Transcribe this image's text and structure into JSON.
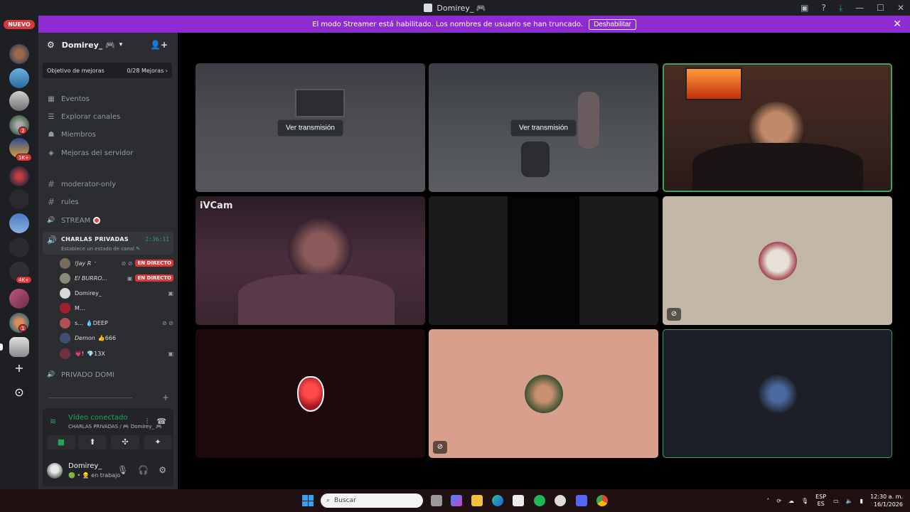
{
  "window": {
    "title": "Domirey_ 🎮"
  },
  "streamer_bar": {
    "message": "El modo Streamer está habilitado. Los nombres de usuario se han truncado.",
    "disable_label": "Deshabilitar",
    "close": "✕"
  },
  "guilds": {
    "nuevo": "NUEVO",
    "badges": [
      "2",
      "1K+",
      "4K+",
      "1"
    ]
  },
  "server": {
    "name": "Domirey_ 🎮",
    "goal_label": "Objetivo de mejoras",
    "goal_value": "0/28 Mejoras ›"
  },
  "menu": [
    {
      "label": "Eventos",
      "icon": "▦"
    },
    {
      "label": "Explorar canales",
      "icon": "☰"
    },
    {
      "label": "Miembros",
      "icon": "☗"
    },
    {
      "label": "Mejoras del servidor",
      "icon": "◈"
    }
  ],
  "channels": [
    {
      "label": "moderator-only",
      "icon": "#"
    },
    {
      "label": "rules",
      "icon": "#"
    },
    {
      "label": "STREAM",
      "icon": "🔊"
    }
  ],
  "active_voice": {
    "name": "CHARLAS PRIVADAS",
    "timer": "2:36:11",
    "status": "Establece un estado de canal ✎"
  },
  "members": [
    {
      "name": "!Jay R",
      "suffix": "ᐩ",
      "live": "EN DIRECTO",
      "color": "#7a6a5a",
      "icons": "⊘ ⊘"
    },
    {
      "name": "El BURRO...",
      "suffix": "",
      "live": "EN DIRECTO",
      "color": "#8a8a7a",
      "icons": "▣"
    },
    {
      "name": "Domirey_",
      "suffix": "",
      "live": "",
      "color": "#d8d8d8",
      "icons": "▣"
    },
    {
      "name": "M...",
      "suffix": "",
      "live": "",
      "color": "#a02030",
      "icons": ""
    },
    {
      "name": "s...",
      "suffix": "💧DEEP",
      "live": "",
      "color": "#b05050",
      "icons": "⊘ ⊘"
    },
    {
      "name": "Demon",
      "suffix": "👍666",
      "live": "",
      "color": "#405070",
      "icons": ""
    },
    {
      "name": "💗!",
      "suffix": "💎13X",
      "live": "",
      "color": "#703040",
      "icons": "▣"
    }
  ],
  "private_channel": {
    "label": "PRIVADO DOMI",
    "icon": "🔊"
  },
  "voice_panel": {
    "title": "Vídeo conectado",
    "subtitle": "CHARLAS PRIVADAS / 🎮 Domirey_ 🎮"
  },
  "user": {
    "name": "Domirey_",
    "status": "🟢 • 👷 en trabajo"
  },
  "stage": {
    "watch_label": "Ver transmisión",
    "ivcam_label": "iVCam"
  },
  "taskbar": {
    "search_placeholder": "Buscar",
    "lang": "ESP",
    "region": "ES",
    "time": "12:30 a. m.",
    "date": "16/1/2026"
  },
  "colors": {
    "accent": "#8f2bd3",
    "online": "#23a559",
    "live": "#da373c",
    "speaking": "#3ba55d"
  }
}
